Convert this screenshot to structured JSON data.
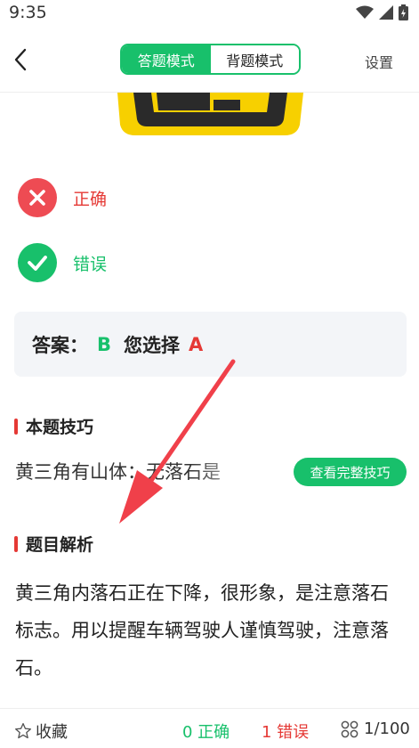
{
  "status_bar": {
    "time": "9:35"
  },
  "nav": {
    "mode_tabs": [
      "答题模式",
      "背题模式"
    ],
    "active_tab": "答题模式",
    "settings_label": "设置"
  },
  "options": [
    {
      "label": "正确",
      "icon": "wrong-mark-icon",
      "label_color": "#e53935"
    },
    {
      "label": "错误",
      "icon": "check-mark-icon",
      "label_color": "#18c06b"
    }
  ],
  "answer": {
    "answer_label": "答案：",
    "answer_value": "B",
    "choice_label": "您选择",
    "choice_value": "A"
  },
  "tips": {
    "title": "本题技巧",
    "text": "黄三角有山体：无落石是",
    "button_label": "查看完整技巧"
  },
  "analysis": {
    "title": "题目解析",
    "text": "黄三角内落石正在下降，很形象，是注意落石标志。用以提醒车辆驾驶人谨慎驾驶，注意落石。"
  },
  "bottom_bar": {
    "favorite_label": "收藏",
    "correct_label": "0 正确",
    "wrong_label": "1 错误",
    "progress_label": "1/100",
    "progress_current": 1,
    "progress_total": 100
  },
  "colors": {
    "accent_green": "#18c06b",
    "error_red": "#e53935",
    "sign_yellow": "#f7d000"
  }
}
